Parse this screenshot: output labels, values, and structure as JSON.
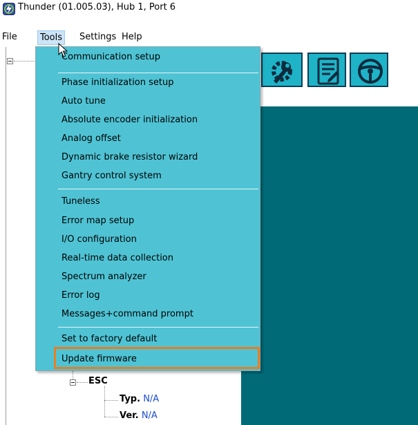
{
  "window": {
    "title": "Thunder (01.005.03), Hub 1, Port 6",
    "app_icon": "thunder-logo-icon"
  },
  "menubar": {
    "items": [
      "File",
      "Tools",
      "Settings",
      "Help"
    ],
    "active": "Tools"
  },
  "toolbar": {
    "buttons": [
      {
        "name": "wrench-gear-icon"
      },
      {
        "name": "document-edit-icon"
      },
      {
        "name": "steering-wheel-icon"
      }
    ],
    "colors": {
      "button_bg": "#1fb3c8",
      "button_border": "#0c3d53",
      "panel_bg": "#006b77"
    }
  },
  "tools_menu": {
    "groups": [
      [
        "Communication setup"
      ],
      [
        "Phase initialization setup",
        "Auto tune",
        "Absolute encoder initialization",
        "Analog offset",
        "Dynamic brake resistor wizard",
        "Gantry control system"
      ],
      [
        "Tuneless",
        "Error map setup",
        "I/O configuration",
        "Real-time data collection",
        "Spectrum analyzer",
        "Error log",
        "Messages+command prompt"
      ],
      [
        "Set to factory default",
        "Update firmware"
      ]
    ],
    "highlighted_item": "Update firmware",
    "colors": {
      "menu_bg": "#4fc3d4",
      "highlight_border": "#ea7d22"
    }
  },
  "tree": {
    "esc_label": "ESC",
    "typ_label": "Typ.",
    "typ_value": "N/A",
    "ver_label": "Ver.",
    "ver_value": "N/A"
  }
}
